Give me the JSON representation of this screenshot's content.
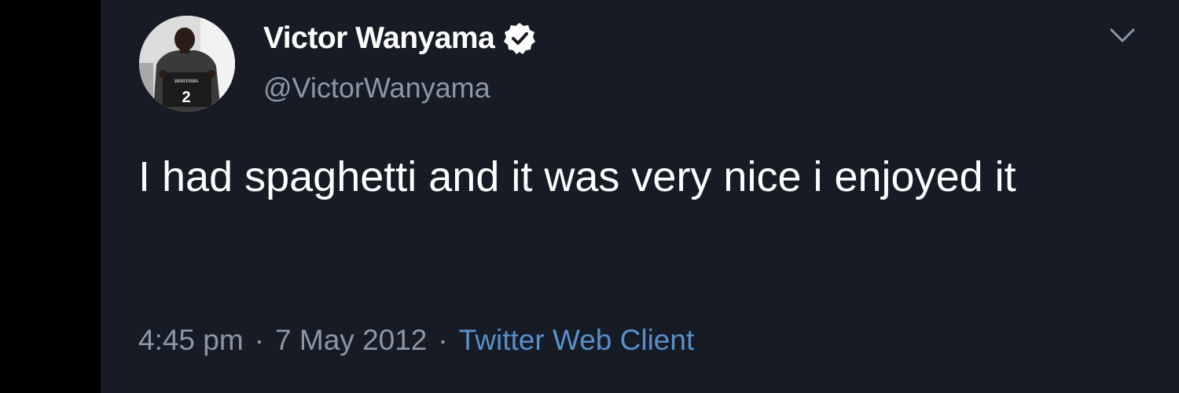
{
  "tweet": {
    "author": {
      "display_name": "Victor Wanyama",
      "handle": "@VictorWanyama",
      "verified": true,
      "avatar_icon": "profile-photo-jersey-number-2"
    },
    "text": "I had spaghetti and it was very nice i enjoyed it",
    "time": "4:45 pm",
    "date": "7 May 2012",
    "separator": "·",
    "source": "Twitter Web Client",
    "menu_icon": "chevron-down-icon"
  },
  "colors": {
    "background": "#161b25",
    "text_primary": "#ffffff",
    "text_secondary": "#8b98a5",
    "link": "#5a8fc9"
  }
}
